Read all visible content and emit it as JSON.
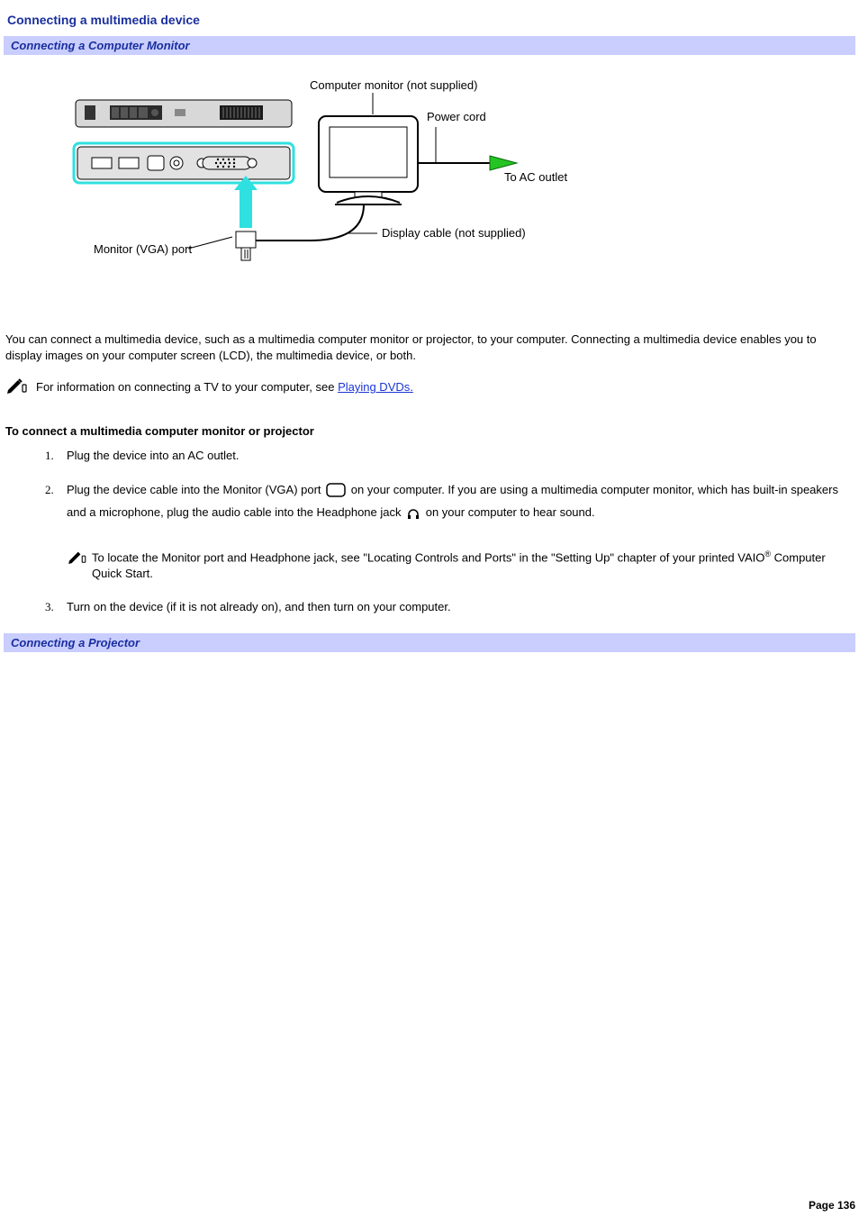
{
  "title": "Connecting a multimedia device",
  "section1": "Connecting a Computer Monitor",
  "section2": "Connecting a Projector",
  "diagram": {
    "label_monitor_not_supplied": "Computer monitor (not supplied)",
    "label_power_cord": "Power cord",
    "label_to_ac": "To AC outlet",
    "label_display_cable": "Display cable (not supplied)",
    "label_vga_port": "Monitor (VGA) port"
  },
  "intro": "You can connect a multimedia device, such as a multimedia computer monitor or projector, to your computer. Connecting a multimedia device enables you to display images on your computer screen (LCD), the multimedia device, or both.",
  "note1_pre": "For information on connecting a TV to your computer, see ",
  "note1_link": "Playing DVDs.",
  "sub_heading": "To connect a multimedia computer monitor or projector",
  "steps": {
    "s1": "Plug the device into an AC outlet.",
    "s2a": "Plug the device cable into the Monitor (VGA) port ",
    "s2b": " on your computer. If you are using a multimedia computer monitor, which has built-in speakers and a microphone, plug the audio cable into the Headphone jack ",
    "s2c": " on your computer to hear sound.",
    "s2_note_a": "To locate the Monitor port and Headphone jack, see \"Locating Controls and Ports\" in the \"Setting Up\" chapter of your printed VAIO",
    "s2_note_b": " Computer Quick Start.",
    "s3": "Turn on the device (if it is not already on), and then turn on your computer."
  },
  "page_number": "Page 136",
  "reg_mark": "®"
}
